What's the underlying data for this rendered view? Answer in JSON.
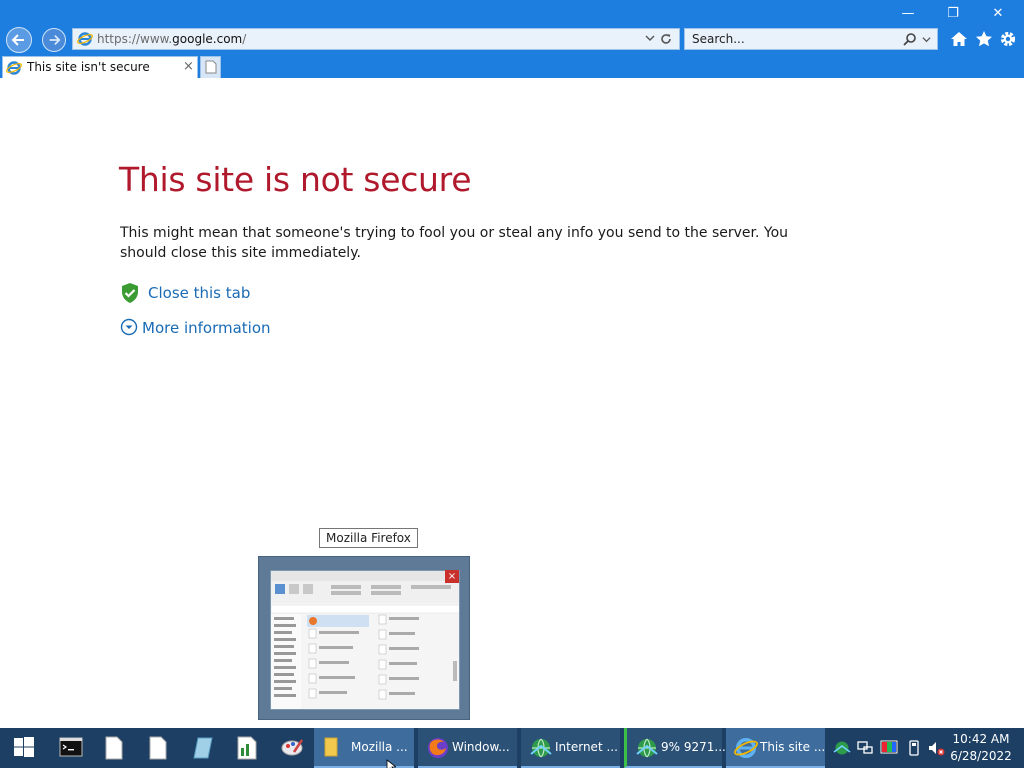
{
  "browser": {
    "address": {
      "prefix": "https://www.",
      "domain": "google.com",
      "suffix": "/"
    },
    "search_placeholder": "Search...",
    "tab_title": "This site isn't secure",
    "tab_close": "×",
    "window_controls": {
      "minimize": "—",
      "restore": "❐",
      "close": "✕"
    }
  },
  "page": {
    "heading": "This site is not secure",
    "paragraph": "This might mean that someone's trying to fool you or steal any info you send to the server. You should close this site immediately.",
    "close_tab_link": "Close this tab",
    "more_info_link": "More information",
    "heading_color": "#b0192c",
    "link_color": "#1a6bb5"
  },
  "tooltip": {
    "text": "Mozilla Firefox"
  },
  "thumbnail": {
    "close": "×"
  },
  "taskbar": {
    "quick_launch": [
      "terminal-icon",
      "document-icon",
      "document-icon",
      "notebook-icon",
      "spreadsheet-icon",
      "paint-icon"
    ],
    "buttons": [
      {
        "label": "Mozilla ...",
        "icon": "folder-icon"
      },
      {
        "label": "Window...",
        "icon": "firefox-icon"
      },
      {
        "label": "Internet ...",
        "icon": "network-globe-icon"
      },
      {
        "label": "9% 9271...",
        "icon": "network-globe-icon"
      },
      {
        "label": "This site ...",
        "icon": "internet-explorer-icon"
      }
    ],
    "clock": {
      "time": "10:42 AM",
      "date": "6/28/2022"
    }
  }
}
